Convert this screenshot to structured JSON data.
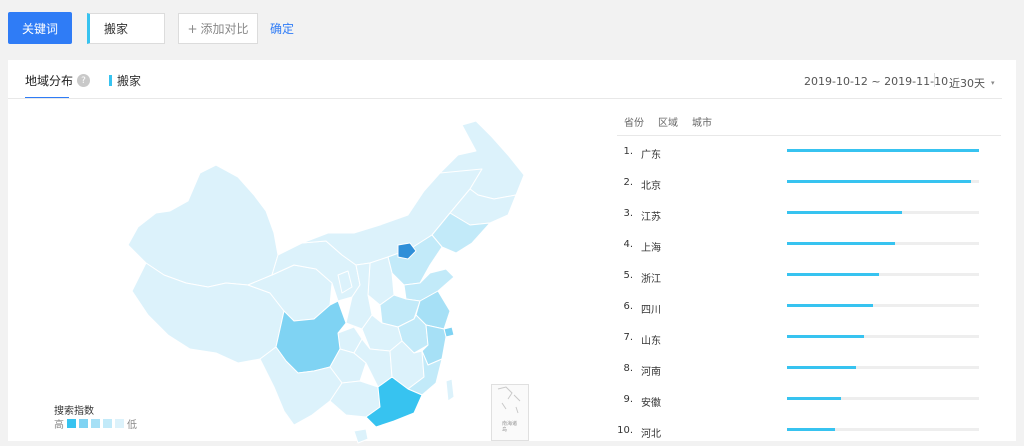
{
  "toolbar": {
    "keyword_tab": "关键词",
    "keyword": "搬家",
    "add_compare": "添加对比",
    "add_icon": "plus-icon",
    "confirm": "确定"
  },
  "panel": {
    "tab_label": "地域分布",
    "help_glyph": "?",
    "series_label": "搬家",
    "date_range": "2019-10-12 ~ 2019-11-10",
    "period": "近30天",
    "period_caret": "▾"
  },
  "map": {
    "legend_title": "搜索指数",
    "legend_high": "高",
    "legend_low": "低",
    "inset_label": "南海诸岛",
    "colors": {
      "level1": "#37c3f0",
      "level2": "#7fd3f3",
      "level3": "#a6e0f6",
      "level4": "#c2eaf9",
      "level5": "#dcf2fb",
      "border": "#ffffff",
      "beijing": "#2f8fd8"
    }
  },
  "ranking": {
    "tabs": [
      "省份",
      "区域",
      "城市"
    ],
    "items": [
      {
        "rank": "1.",
        "name": "广东",
        "value": 1.0
      },
      {
        "rank": "2.",
        "name": "北京",
        "value": 0.96
      },
      {
        "rank": "3.",
        "name": "江苏",
        "value": 0.6
      },
      {
        "rank": "4.",
        "name": "上海",
        "value": 0.56
      },
      {
        "rank": "5.",
        "name": "浙江",
        "value": 0.48
      },
      {
        "rank": "6.",
        "name": "四川",
        "value": 0.45
      },
      {
        "rank": "7.",
        "name": "山东",
        "value": 0.4
      },
      {
        "rank": "8.",
        "name": "河南",
        "value": 0.36
      },
      {
        "rank": "9.",
        "name": "安徽",
        "value": 0.28
      },
      {
        "rank": "10.",
        "name": "河北",
        "value": 0.25
      }
    ]
  }
}
